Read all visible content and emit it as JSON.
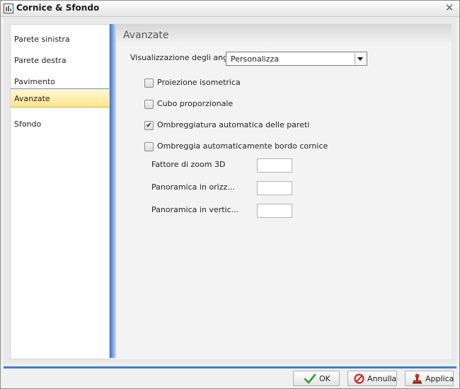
{
  "window": {
    "title": "Cornice & Sfondo",
    "app_icon": "chart-app-icon",
    "close_icon": "close-icon"
  },
  "sidebar": {
    "items": [
      {
        "label": "Parete sinistra",
        "active": false
      },
      {
        "label": "Parete destra",
        "active": false
      },
      {
        "label": "Pavimento",
        "active": false
      },
      {
        "label": "Avanzate",
        "active": true
      },
      {
        "label": "Sfondo",
        "active": false
      }
    ]
  },
  "content": {
    "section_title": "Avanzate",
    "corners": {
      "label": "Visualizzazione degli angoli",
      "value": "Personalizza"
    },
    "checkboxes": [
      {
        "label": "Proiezione isometrica",
        "checked": false
      },
      {
        "label": "Cubo proporzionale",
        "checked": false
      },
      {
        "label": "Ombreggiatura automatica delle pareti",
        "checked": true
      },
      {
        "label": "Ombreggia automaticamente bordo cornice",
        "checked": false
      }
    ],
    "fields": [
      {
        "label": "Fattore di zoom 3D",
        "value": ""
      },
      {
        "label": "Panoramica in orizz...",
        "value": ""
      },
      {
        "label": "Panoramica in vertic...",
        "value": ""
      }
    ]
  },
  "footer": {
    "ok_label": "OK",
    "cancel_label": "Annulla",
    "apply_label": "Applica",
    "ok_icon": "checkmark-icon",
    "cancel_icon": "no-entry-icon",
    "apply_icon": "stamp-icon"
  },
  "colors": {
    "accent": "#4a7cc9",
    "active_item": "#ffe48a"
  }
}
